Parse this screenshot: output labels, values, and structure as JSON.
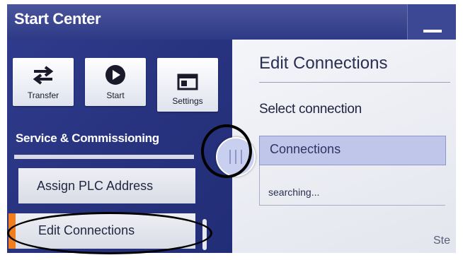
{
  "window": {
    "title": "Start Center"
  },
  "toolbar": [
    {
      "label": "Transfer",
      "icon": "transfer-arrows-icon"
    },
    {
      "label": "Start",
      "icon": "play-circle-icon"
    },
    {
      "label": "Settings",
      "icon": "settings-window-icon"
    }
  ],
  "sidebar": {
    "section_title": "Service & Commissioning",
    "items": [
      {
        "label": "Assign PLC Address"
      },
      {
        "label": "Edit Connections",
        "selected": true
      }
    ]
  },
  "panel": {
    "title": "Edit Connections",
    "select_label": "Select connection",
    "connections_header": "Connections",
    "status": "searching...",
    "partial_text": "Ste"
  },
  "colors": {
    "title_bar": "#3a4590",
    "sidebar_bg": "#28337f",
    "accent_orange": "#f07d1e",
    "selected_row": "#bfc6ea"
  }
}
